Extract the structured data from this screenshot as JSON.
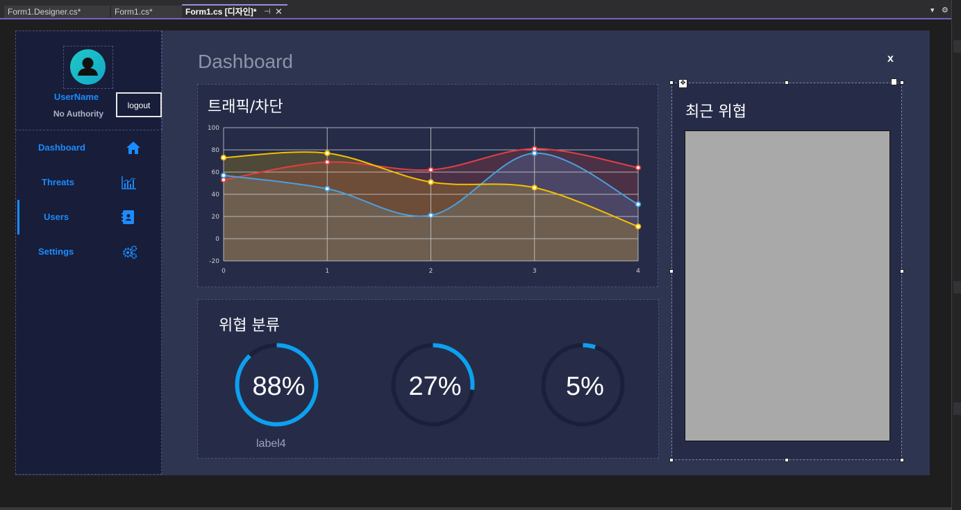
{
  "ide": {
    "tabs": [
      {
        "label": "Form1.Designer.cs*"
      },
      {
        "label": "Form1.cs*"
      },
      {
        "label": "Form1.cs [디자인]*"
      }
    ],
    "pin_glyph": "⊣",
    "close_glyph": "✕",
    "dropdown_glyph": "▾",
    "settings_glyph": "⚙"
  },
  "sidebar": {
    "username": "UserName",
    "authority": "No Authority",
    "logout_label": "logout",
    "accent_color": "#1a8cff",
    "items": [
      {
        "label": "Dashboard",
        "icon": "home-icon"
      },
      {
        "label": "Threats",
        "icon": "bar-chart-icon"
      },
      {
        "label": "Users",
        "icon": "address-book-icon"
      },
      {
        "label": "Settings",
        "icon": "gears-icon"
      }
    ]
  },
  "main": {
    "title": "Dashboard",
    "close_label": "x"
  },
  "traffic_panel": {
    "title": "트래픽/차단"
  },
  "classification_panel": {
    "title": "위협 분류",
    "gauges": [
      {
        "value_text": "88%",
        "value": 88,
        "label": "label4"
      },
      {
        "value_text": "27%",
        "value": 27,
        "label": ""
      },
      {
        "value_text": "5%",
        "value": 5,
        "label": ""
      }
    ],
    "gauge_color": "#0ea0f0",
    "track_color": "#1a2039"
  },
  "threat_panel": {
    "title": "최근 위협"
  },
  "chart_data": {
    "type": "line",
    "x": [
      0,
      1,
      2,
      3,
      4
    ],
    "xlim": [
      0,
      4
    ],
    "ylim": [
      -20,
      100
    ],
    "yticks": [
      -20,
      0,
      20,
      40,
      60,
      80,
      100
    ],
    "xticks": [
      0,
      1,
      2,
      3,
      4
    ],
    "grid": true,
    "smooth": true,
    "series": [
      {
        "values": [
          53,
          69,
          62,
          81,
          64
        ],
        "color": "#e04040"
      },
      {
        "values": [
          57,
          45,
          21,
          77,
          31
        ],
        "color": "#4aa0e0"
      },
      {
        "values": [
          73,
          77,
          51,
          46,
          11
        ],
        "color": "#f5c000"
      }
    ]
  }
}
